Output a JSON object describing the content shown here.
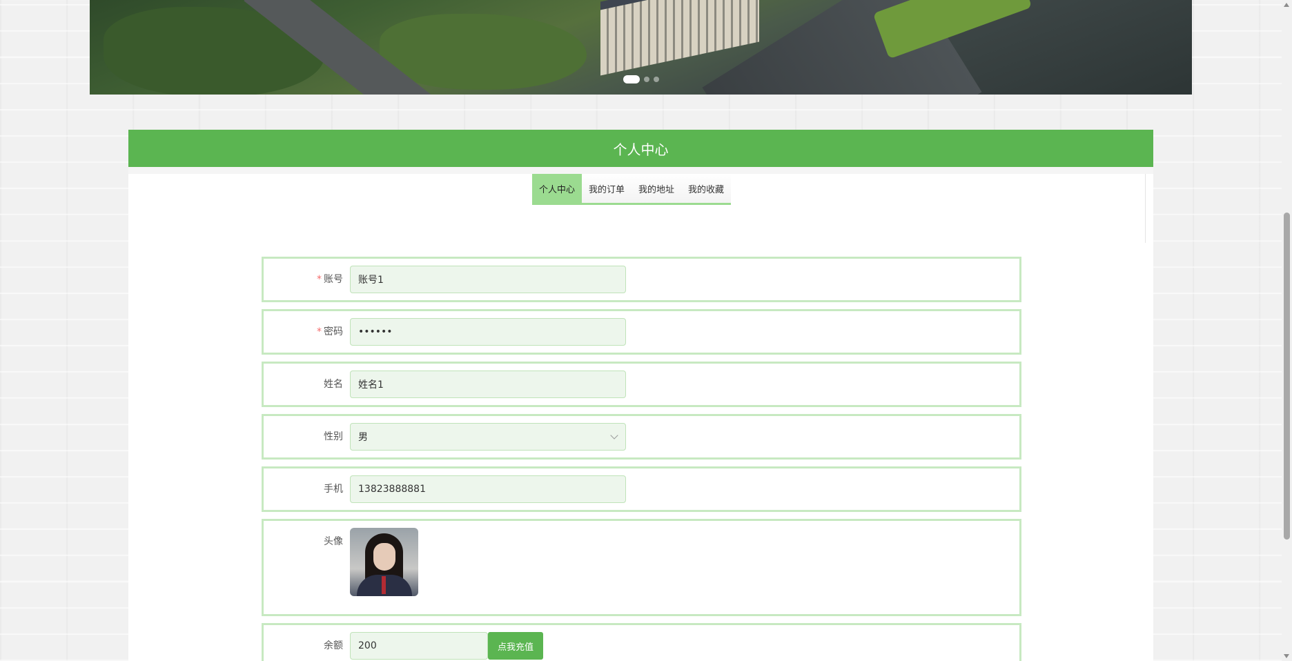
{
  "banner": {
    "slides": 3,
    "active_slide": 1
  },
  "panel": {
    "title": "个人中心"
  },
  "tabs": [
    {
      "label": "个人中心",
      "active": true
    },
    {
      "label": "我的订单",
      "active": false
    },
    {
      "label": "我的地址",
      "active": false
    },
    {
      "label": "我的收藏",
      "active": false
    }
  ],
  "form": {
    "account": {
      "label": "账号",
      "required": true,
      "value": "账号1"
    },
    "password": {
      "label": "密码",
      "required": true,
      "value": "••••••"
    },
    "name": {
      "label": "姓名",
      "value": "姓名1"
    },
    "gender": {
      "label": "性别",
      "value": "男"
    },
    "phone": {
      "label": "手机",
      "value": "13823888881"
    },
    "avatar": {
      "label": "头像"
    },
    "balance": {
      "label": "余额",
      "value": "200",
      "recharge_label": "点我充值"
    }
  },
  "colors": {
    "accent": "#5bb551",
    "tab_active": "#9bdb90",
    "row_border": "#c7e9c1",
    "field_bg": "#edf6ec",
    "required": "#f56c6c"
  }
}
